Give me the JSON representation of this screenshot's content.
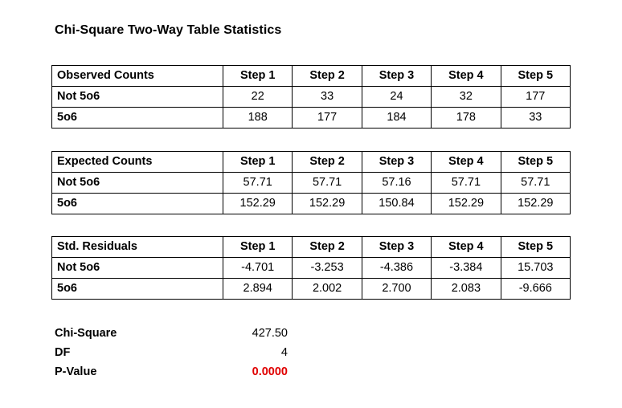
{
  "title": "Chi-Square Two-Way Table Statistics",
  "colors": {
    "text": "#000000",
    "border": "#000000",
    "background": "#ffffff",
    "pvalue_highlight": "#e00000"
  },
  "tables": [
    {
      "corner_label": "Observed Counts",
      "columns": [
        "Step 1",
        "Step 2",
        "Step 3",
        "Step 4",
        "Step 5"
      ],
      "rows": [
        {
          "label": "Not 5o6",
          "values": [
            "22",
            "33",
            "24",
            "32",
            "177"
          ]
        },
        {
          "label": "5o6",
          "values": [
            "188",
            "177",
            "184",
            "178",
            "33"
          ]
        }
      ]
    },
    {
      "corner_label": "Expected Counts",
      "columns": [
        "Step 1",
        "Step 2",
        "Step 3",
        "Step 4",
        "Step 5"
      ],
      "rows": [
        {
          "label": "Not 5o6",
          "values": [
            "57.71",
            "57.71",
            "57.16",
            "57.71",
            "57.71"
          ]
        },
        {
          "label": "5o6",
          "values": [
            "152.29",
            "152.29",
            "150.84",
            "152.29",
            "152.29"
          ]
        }
      ]
    },
    {
      "corner_label": "Std. Residuals",
      "columns": [
        "Step 1",
        "Step 2",
        "Step 3",
        "Step 4",
        "Step 5"
      ],
      "rows": [
        {
          "label": "Not 5o6",
          "values": [
            "-4.701",
            "-3.253",
            "-4.386",
            "-3.384",
            "15.703"
          ]
        },
        {
          "label": "5o6",
          "values": [
            "2.894",
            "2.002",
            "2.700",
            "2.083",
            "-9.666"
          ]
        }
      ]
    }
  ],
  "summary": [
    {
      "label": "Chi-Square",
      "value": "427.50",
      "highlight": false
    },
    {
      "label": "DF",
      "value": "4",
      "highlight": false
    },
    {
      "label": "P-Value",
      "value": "0.0000",
      "highlight": true
    }
  ]
}
